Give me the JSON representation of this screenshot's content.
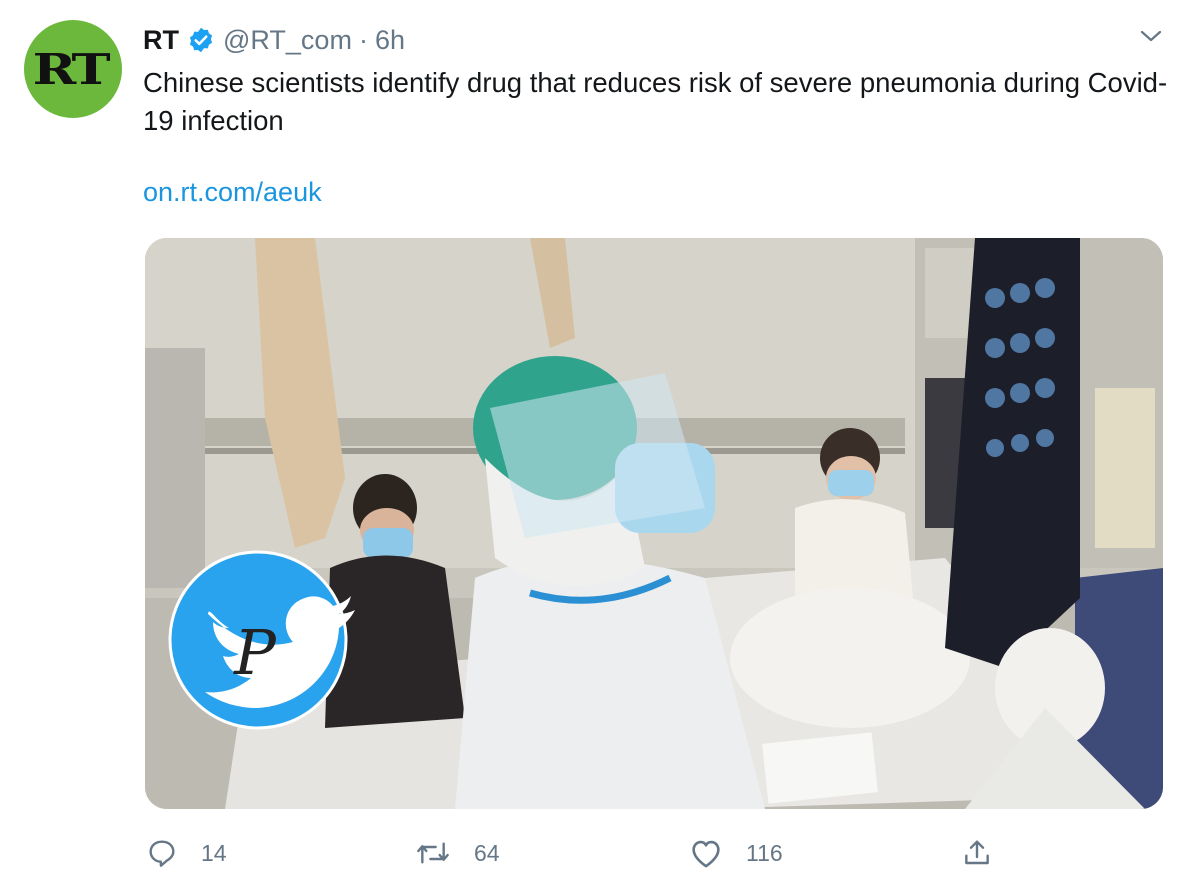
{
  "tweet": {
    "avatar": {
      "text": "RT",
      "color": "#6cb83c",
      "icon": "rt-logo"
    },
    "name": "RT",
    "verified_icon": "verified-badge-icon",
    "handle": "@RT_com",
    "separator": "·",
    "time": "6h",
    "more_icon": "chevron-down-icon",
    "text": "Chinese scientists identify drug that reduces risk of severe pneumonia during Covid-19 infection",
    "link": "on.rt.com/aeuk",
    "media": {
      "description_icon": "hospital-photo",
      "overlay_icon": "twitter-bird-watermark"
    },
    "actions": {
      "reply": {
        "icon": "reply-icon",
        "count": "14"
      },
      "retweet": {
        "icon": "retweet-icon",
        "count": "64"
      },
      "like": {
        "icon": "heart-icon",
        "count": "116"
      },
      "share": {
        "icon": "share-icon"
      }
    },
    "colors": {
      "link": "#1b95e0",
      "secondary": "#657786",
      "verified": "#1da1f2",
      "brand_green": "#6cb83c"
    }
  }
}
